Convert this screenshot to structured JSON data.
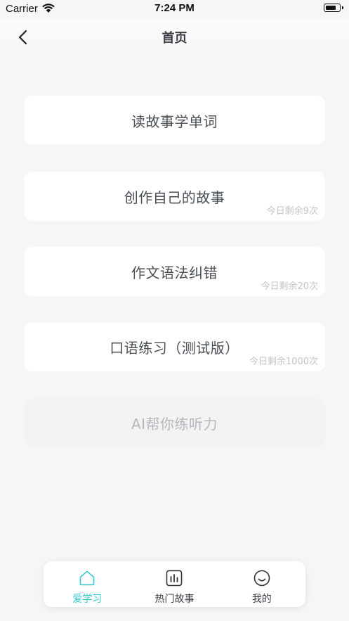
{
  "status_bar": {
    "carrier": "Carrier",
    "time": "7:24 PM"
  },
  "nav": {
    "title": "首页",
    "back_icon": "chevron-left-icon"
  },
  "cards": [
    {
      "title": "读故事学单词",
      "quota": ""
    },
    {
      "title": "创作自己的故事",
      "quota": "今日剩余9次"
    },
    {
      "title": "作文语法纠错",
      "quota": "今日剩余20次"
    },
    {
      "title": "口语练习（测试版）",
      "quota": "今日剩余1000次"
    },
    {
      "title": "AI帮你练听力",
      "quota": "",
      "disabled": true
    }
  ],
  "tabs": [
    {
      "label": "爱学习",
      "icon": "home-icon",
      "active": true
    },
    {
      "label": "热门故事",
      "icon": "chart-icon",
      "active": false
    },
    {
      "label": "我的",
      "icon": "smile-icon",
      "active": false
    }
  ],
  "colors": {
    "accent": "#35c9d2",
    "background": "#f6f6f6",
    "card": "#ffffff",
    "text": "#3b3f45",
    "quota_text": "#c3c5c9"
  }
}
